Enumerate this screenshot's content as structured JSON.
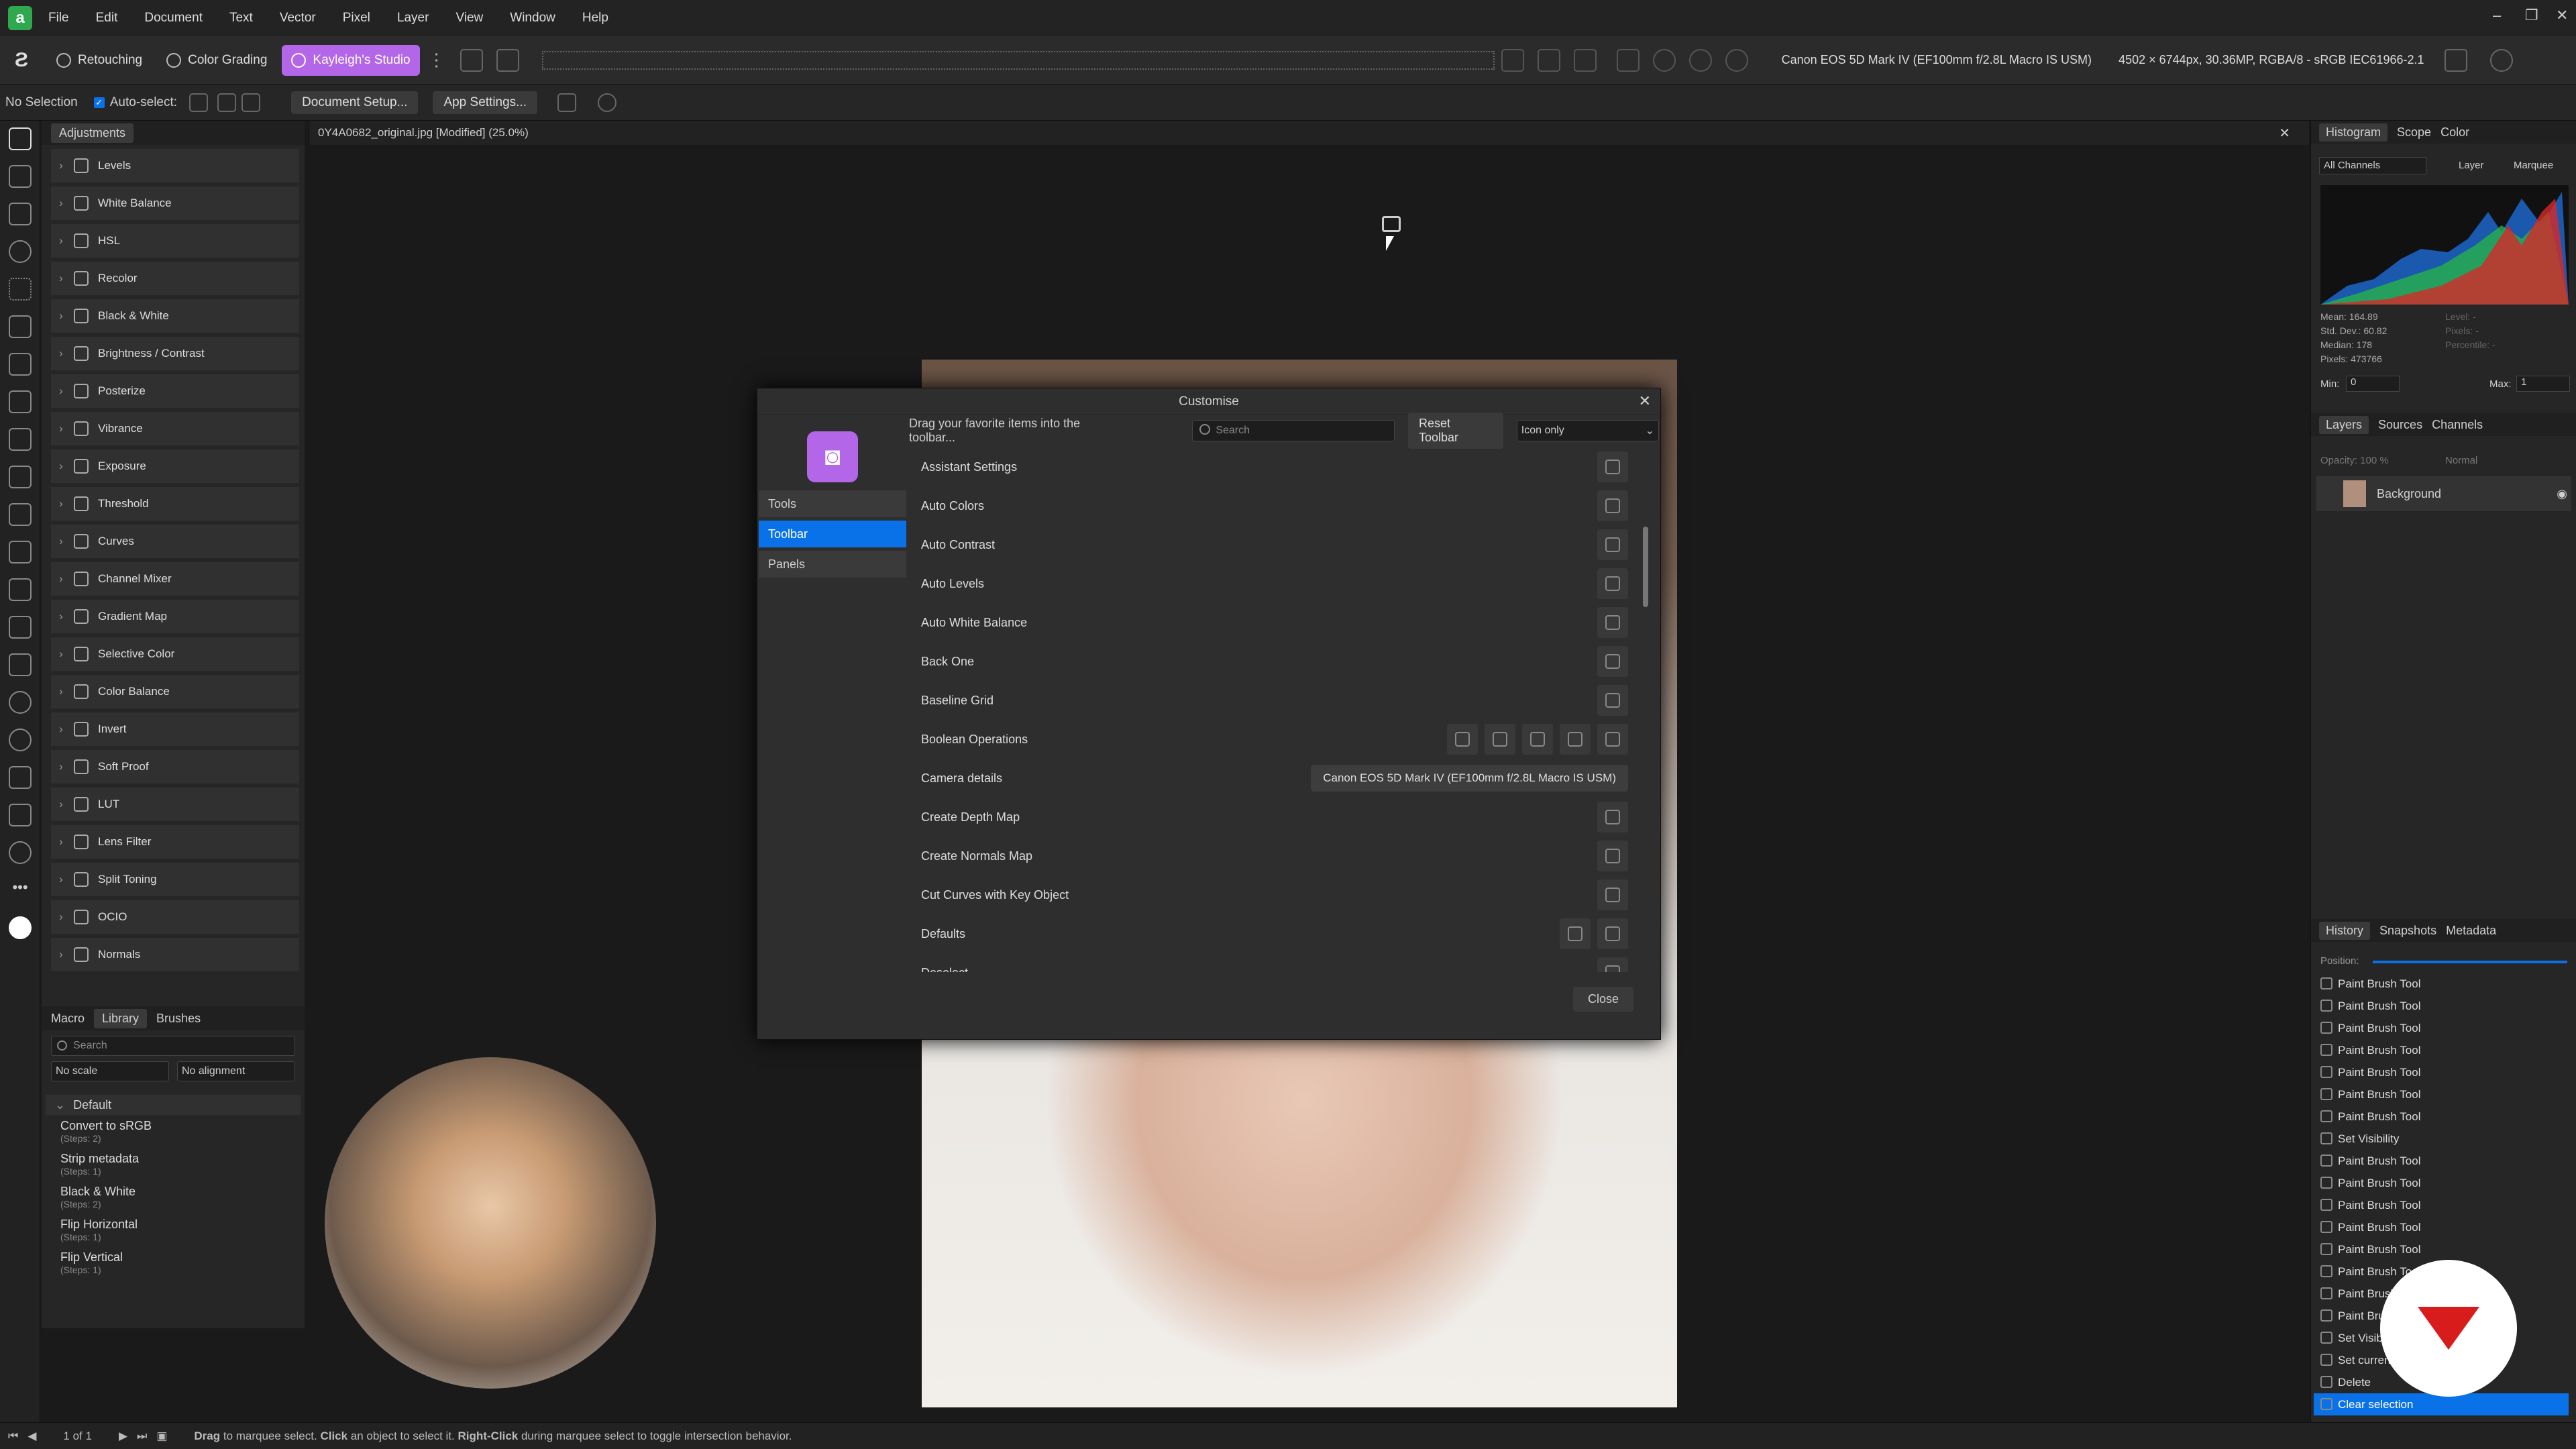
{
  "menubar": {
    "items": [
      "File",
      "Edit",
      "Document",
      "Text",
      "Vector",
      "Pixel",
      "Layer",
      "View",
      "Window",
      "Help"
    ]
  },
  "toolbar": {
    "personas": [
      "Retouching",
      "Color Grading",
      "Kayleigh's Studio"
    ],
    "camera_info": "Canon EOS 5D Mark IV (EF100mm f/2.8L Macro IS USM)",
    "image_info": "4502 × 6744px, 30.36MP, RGBA/8 - sRGB IEC61966-2.1"
  },
  "context": {
    "selection": "No Selection",
    "autoselect": "Auto-select:",
    "doc_setup": "Document Setup...",
    "app_settings": "App Settings..."
  },
  "adjustments": {
    "tab": "Adjustments",
    "items": [
      "Levels",
      "White Balance",
      "HSL",
      "Recolor",
      "Black & White",
      "Brightness / Contrast",
      "Posterize",
      "Vibrance",
      "Exposure",
      "Threshold",
      "Curves",
      "Channel Mixer",
      "Gradient Map",
      "Selective Color",
      "Color Balance",
      "Invert",
      "Soft Proof",
      "LUT",
      "Lens Filter",
      "Split Toning",
      "OCIO",
      "Normals"
    ]
  },
  "library": {
    "tabs": [
      "Macro",
      "Library",
      "Brushes"
    ],
    "search_placeholder": "Search",
    "scale": "No scale",
    "alignment": "No alignment",
    "group": "Default",
    "items": [
      {
        "name": "Convert to sRGB",
        "steps": "(Steps: 2)"
      },
      {
        "name": "Strip metadata",
        "steps": "(Steps: 1)"
      },
      {
        "name": "Black & White",
        "steps": "(Steps: 2)"
      },
      {
        "name": "Flip Horizontal",
        "steps": "(Steps: 1)"
      },
      {
        "name": "Flip Vertical",
        "steps": "(Steps: 1)"
      }
    ]
  },
  "document": {
    "tab_title": "0Y4A0682_original.jpg [Modified] (25.0%)"
  },
  "dialog": {
    "title": "Customise",
    "instruction": "Drag your favorite items into the toolbar...",
    "search_placeholder": "Search",
    "reset_label": "Reset Toolbar",
    "mode": "Icon only",
    "sidebar": [
      "Tools",
      "Toolbar",
      "Panels"
    ],
    "rows": [
      "Assistant Settings",
      "Auto Colors",
      "Auto Contrast",
      "Auto Levels",
      "Auto White Balance",
      "Back One",
      "Baseline Grid",
      "Boolean Operations",
      "Camera details",
      "Create Depth Map",
      "Create Normals Map",
      "Cut Curves with Key Object",
      "Defaults",
      "Deselect"
    ],
    "camera_details_value": "Canon EOS 5D Mark IV (EF100mm f/2.8L Macro IS USM)",
    "close_label": "Close"
  },
  "right": {
    "hist_tabs": [
      "Histogram",
      "Scope",
      "Color"
    ],
    "channels": "All Channels",
    "layer_opt": "Layer",
    "marquee_opt": "Marquee",
    "stats": [
      "Mean: 164.89",
      "Std. Dev.: 60.82",
      "Median: 178",
      "Pixels: 473766"
    ],
    "stats_right": [
      "Level: -",
      "Pixels: -",
      "Percentile: -"
    ],
    "min_label": "Min:",
    "min_val": "0",
    "max_label": "Max:",
    "max_val": "1",
    "layer_tabs": [
      "Layers",
      "Sources",
      "Channels"
    ],
    "opacity": "Opacity: 100 %",
    "blend": "Normal",
    "layer_name": "Background",
    "history_tabs": [
      "History",
      "Snapshots",
      "Metadata"
    ],
    "position_label": "Position:",
    "history": [
      "Paint Brush Tool",
      "Paint Brush Tool",
      "Paint Brush Tool",
      "Paint Brush Tool",
      "Paint Brush Tool",
      "Paint Brush Tool",
      "Paint Brush Tool",
      "Set Visibility",
      "Paint Brush Tool",
      "Paint Brush Tool",
      "Paint Brush Tool",
      "Paint Brush Tool",
      "Paint Brush Tool",
      "Paint Brush Tool",
      "Paint Brush Tool",
      "Paint Brush Tool",
      "Set Visibility",
      "Set current",
      "Delete",
      "Clear selection"
    ]
  },
  "status": {
    "page": "1 of 1",
    "hint_drag": "Drag",
    "hint1": " to marquee select. ",
    "hint_click": "Click",
    "hint2": " an object to select it. ",
    "hint_right": "Right-Click",
    "hint3": " during marquee select to toggle intersection behavior."
  }
}
